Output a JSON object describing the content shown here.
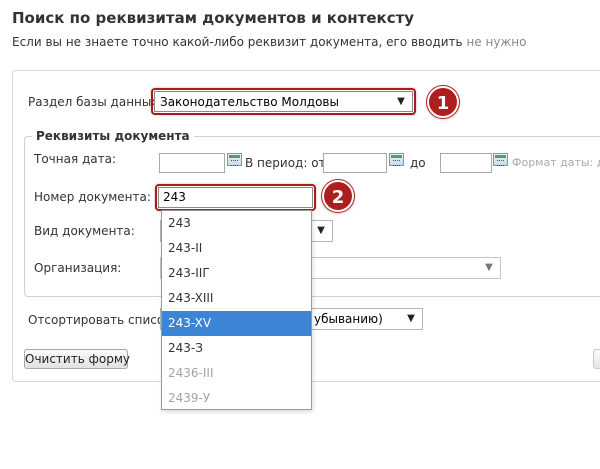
{
  "header": {
    "title": "Поиск по реквизитам документов и контексту",
    "subtitle_main": "Если вы не знаете точно какой-либо реквизит документа, его вводить",
    "subtitle_muted": " не нужно"
  },
  "form": {
    "section_label": "Раздел базы данных:",
    "section_value": "Законодательство Молдовы",
    "fieldset_legend": "Реквизиты документа",
    "exact_date_label": "Точная дата:",
    "period_label": "В период: от",
    "period_to_label": "до",
    "date_format_hint": "Формат даты: д",
    "doc_number_label": "Номер документа:",
    "doc_number_value": "243",
    "doc_type_label": "Вид документа:",
    "organization_label": "Организация:",
    "sort_label_left": "Отсортировать список д",
    "sort_label_right": "убыванию)",
    "clear_button": "Очистить форму"
  },
  "badges": {
    "one": "1",
    "two": "2"
  },
  "autocomplete": {
    "items": [
      "243",
      "243-II",
      "243-IIГ",
      "243-XIII",
      "243-XV",
      "243-З",
      "2436-III",
      "2439-У"
    ],
    "selected_value": "243-XV"
  },
  "icons": {
    "dropdown_arrow": "chevron-down-icon",
    "calendar": "calendar-icon"
  },
  "colors": {
    "accent_red": "#ad1f1f",
    "selection_blue": "#3c84d6"
  }
}
